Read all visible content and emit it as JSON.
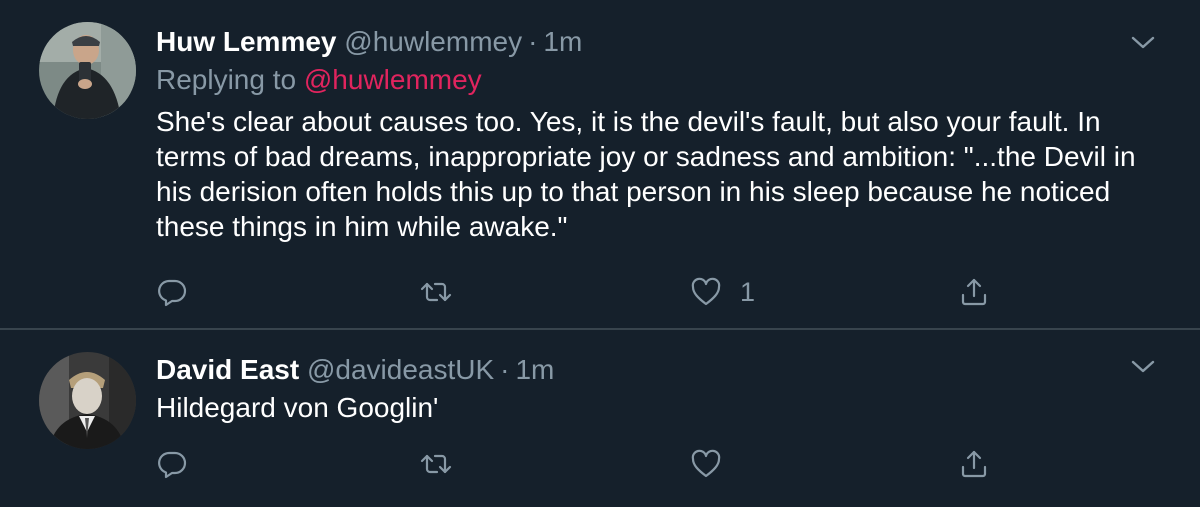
{
  "tweets": [
    {
      "author_name": "Huw Lemmey",
      "author_handle": "@huwlemmey",
      "separator": "·",
      "timestamp": "1m",
      "reply_prefix": "Replying to",
      "reply_to": "@huwlemmey",
      "text": "She's clear about causes too. Yes, it is the devil's fault, but also your fault. In terms of bad dreams, inappropriate joy or sadness and ambition: \"...the Devil in his derision often holds this up to that person in his sleep because he noticed these things in him while awake.\"",
      "like_count": "1"
    },
    {
      "author_name": "David East",
      "author_handle": "@davideastUK",
      "separator": "·",
      "timestamp": "1m",
      "text": "Hildegard von Googlin'"
    }
  ],
  "icons": {
    "reply": "reply-icon",
    "retweet": "retweet-icon",
    "like": "heart-icon",
    "share": "share-icon",
    "menu": "chevron-down-icon"
  },
  "colors": {
    "background": "#15202b",
    "divider": "#38444d",
    "secondary_text": "#8899a6",
    "mention": "#e0245e"
  }
}
